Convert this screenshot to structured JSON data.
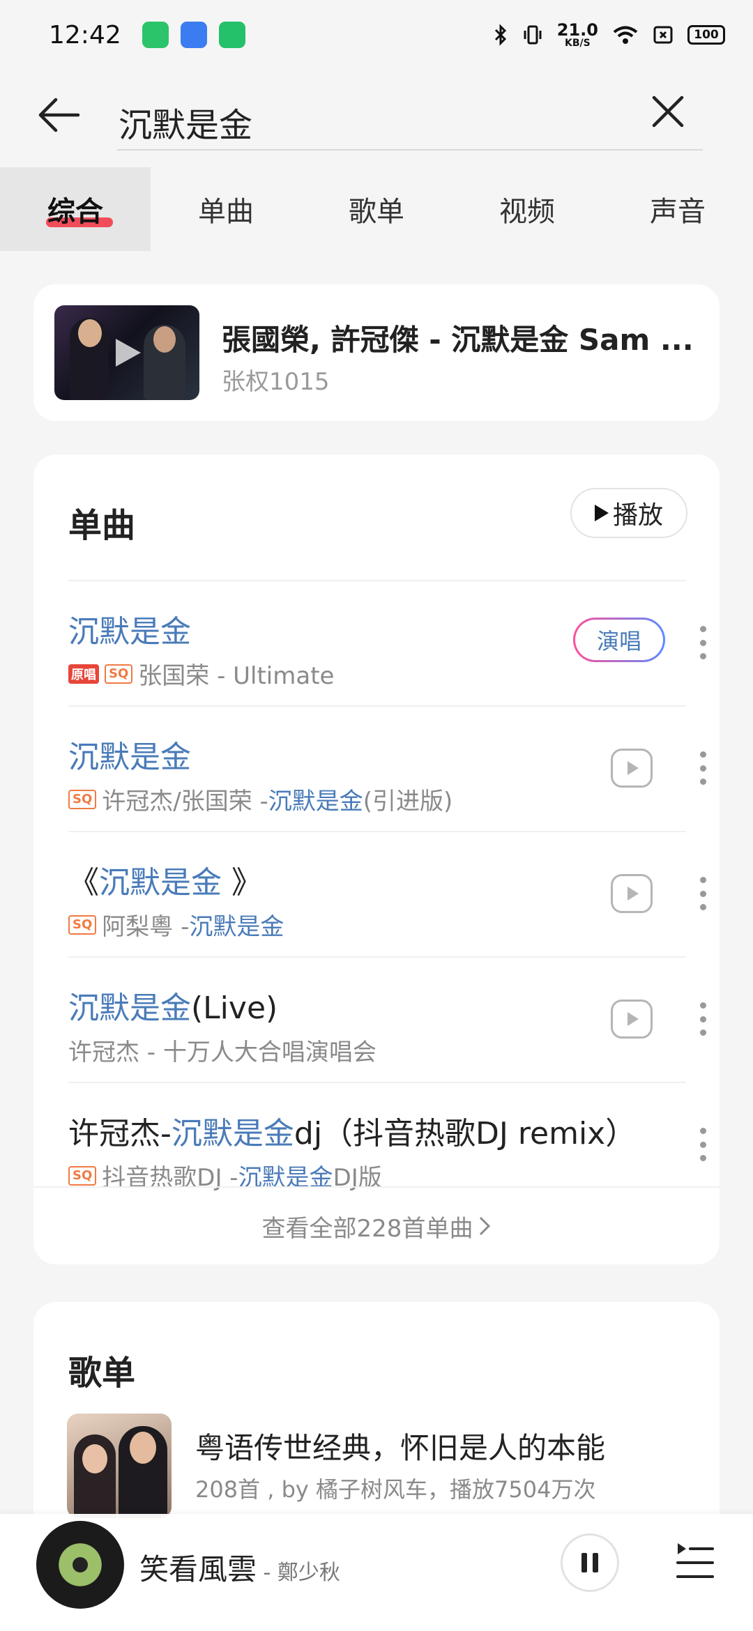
{
  "status_bar": {
    "time": "12:42",
    "net_speed": "21.0",
    "net_unit": "KB/S",
    "battery": "100",
    "app_colors": [
      "#2cc46b",
      "#3b7df0",
      "#25c06a"
    ]
  },
  "search": {
    "query": "沉默是金"
  },
  "tabs": [
    {
      "label": "综合",
      "active": true
    },
    {
      "label": "单曲",
      "active": false
    },
    {
      "label": "歌单",
      "active": false
    },
    {
      "label": "视频",
      "active": false
    },
    {
      "label": "声音",
      "active": false
    }
  ],
  "video": {
    "title": "張國榮, 許冠傑 - 沉默是金 Sam ...",
    "uploader": "张权1015"
  },
  "songs_section": {
    "title": "单曲",
    "play_all": "播放",
    "sing_label": "演唱",
    "view_all": "查看全部228首单曲",
    "badge_original": "原唱",
    "badge_sq": "SQ",
    "items": [
      {
        "title_pre": "",
        "title_hl": "沉默是金",
        "title_post": "",
        "artist": "张国荣 - Ultimate",
        "album_hl": "",
        "album_post": ""
      },
      {
        "title_pre": "",
        "title_hl": "沉默是金",
        "title_post": "",
        "artist": "许冠杰/张国荣 - ",
        "album_hl": "沉默是金",
        "album_post": "(引进版)"
      },
      {
        "title_pre": "《",
        "title_hl": "沉默是金",
        "title_post": " 》",
        "artist": "阿梨粵 - ",
        "album_hl": "沉默是金",
        "album_post": ""
      },
      {
        "title_pre": "",
        "title_hl": "沉默是金",
        "title_post": "(Live)",
        "artist": "许冠杰 - 十万人大合唱演唱会",
        "album_hl": "",
        "album_post": ""
      },
      {
        "title_pre": "许冠杰-",
        "title_hl": "沉默是金",
        "title_post": "dj（抖音热歌DJ remix）",
        "artist": "抖音热歌DJ - ",
        "album_hl": "沉默是金",
        "album_post": "DJ版"
      }
    ]
  },
  "playlist_section": {
    "title": "歌单",
    "item": {
      "title": "粤语传世经典，怀旧是人的本能",
      "meta": "208首 , by 橘子树风车，播放7504万次"
    }
  },
  "player": {
    "song": "笑看風雲",
    "artist": " - 鄭少秋"
  },
  "colors": {
    "highlight": "#4a7bb8",
    "accent_red": "#f23b4a"
  }
}
